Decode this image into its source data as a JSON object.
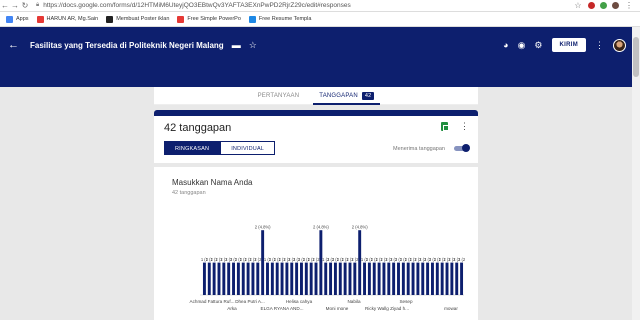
{
  "browser": {
    "url": "https://docs.google.com/forms/d/12HTMiM6UteyjQO3EBtwQv3YAFTA3EXnPwPD2RjrZ29c/edit#responses"
  },
  "bookmarks": [
    {
      "label": "Apps",
      "color": "#4285f4"
    },
    {
      "label": "HARUN AR, Mg.Sain",
      "color": "#e53935"
    },
    {
      "label": "Membuat Poster iklan",
      "color": "#222222"
    },
    {
      "label": "Free Simple PowerPo",
      "color": "#e53935"
    },
    {
      "label": "Free Resume Templa",
      "color": "#1e88e5"
    }
  ],
  "header": {
    "title": "Fasilitas yang Tersedia di Politeknik Negeri Malang",
    "send_label": "KIRIM",
    "accent": "#0d1f6e"
  },
  "tabs": {
    "questions": "PERTANYAAN",
    "responses": "TANGGAPAN",
    "count": "42"
  },
  "summary": {
    "response_count": "42 tanggapan",
    "segment_summary": "RINGKASAN",
    "segment_individual": "INDIVIDUAL",
    "accepting_label": "Menerima tanggapan",
    "accepting": true
  },
  "question": {
    "title": "Masukkan Nama Anda",
    "subtitle": "42 tanggapan"
  },
  "chart_data": {
    "type": "bar",
    "color": "#0d1f6e",
    "ylim": [
      0,
      2.5
    ],
    "values": [
      1,
      1,
      1,
      1,
      1,
      1,
      1,
      1,
      1,
      1,
      1,
      1,
      2,
      1,
      1,
      1,
      1,
      1,
      1,
      1,
      1,
      1,
      1,
      1,
      2,
      1,
      1,
      1,
      1,
      1,
      1,
      1,
      2,
      1,
      1,
      1,
      1,
      1,
      1,
      1,
      1,
      1,
      1,
      1,
      1,
      1,
      1,
      1,
      1,
      1,
      1,
      1,
      1,
      1
    ],
    "bar_labels": [
      "1 (2",
      "1 (2",
      "1 (2",
      "1 (2",
      "1 (2",
      "1 (2",
      "1 (2",
      "1 (2",
      "1 (2",
      "1 (2",
      "1 (2",
      "1 (2",
      "2 (4.8%)",
      "1 (2",
      "1 (2",
      "1 (2",
      "1 (2",
      "1 (2",
      "1 (2",
      "1 (2",
      "1 (2",
      "1 (2",
      "1 (2",
      "1 (2",
      "2 (4.8%)",
      "1 (2",
      "1 (2",
      "1 (2",
      "1 (2",
      "1 (2",
      "1 (2",
      "1 (2",
      "2 (4.8%)",
      "1 (2",
      "1 (2",
      "1 (2",
      "1 (2",
      "1 (2",
      "1 (2",
      "1 (2",
      "1 (2",
      "1 (2",
      "1 (2",
      "1 (2",
      "1 (2",
      "1 (2",
      "1 (2",
      "1 (2",
      "1 (2",
      "1 (2",
      "1 (2",
      "1 (2",
      "1 (2",
      "1 (2"
    ],
    "x_labels_row1": [
      "Achmad Fattura Ruf...",
      "Dhea Putri A...",
      "Helisa cahya",
      "Nabila",
      "Sesep"
    ],
    "x_labels_row2": [
      "Arka",
      "ELGA RYANA AND...",
      "Moni mone",
      "Ricky Wallg Ziyad h...",
      "mowar"
    ]
  }
}
